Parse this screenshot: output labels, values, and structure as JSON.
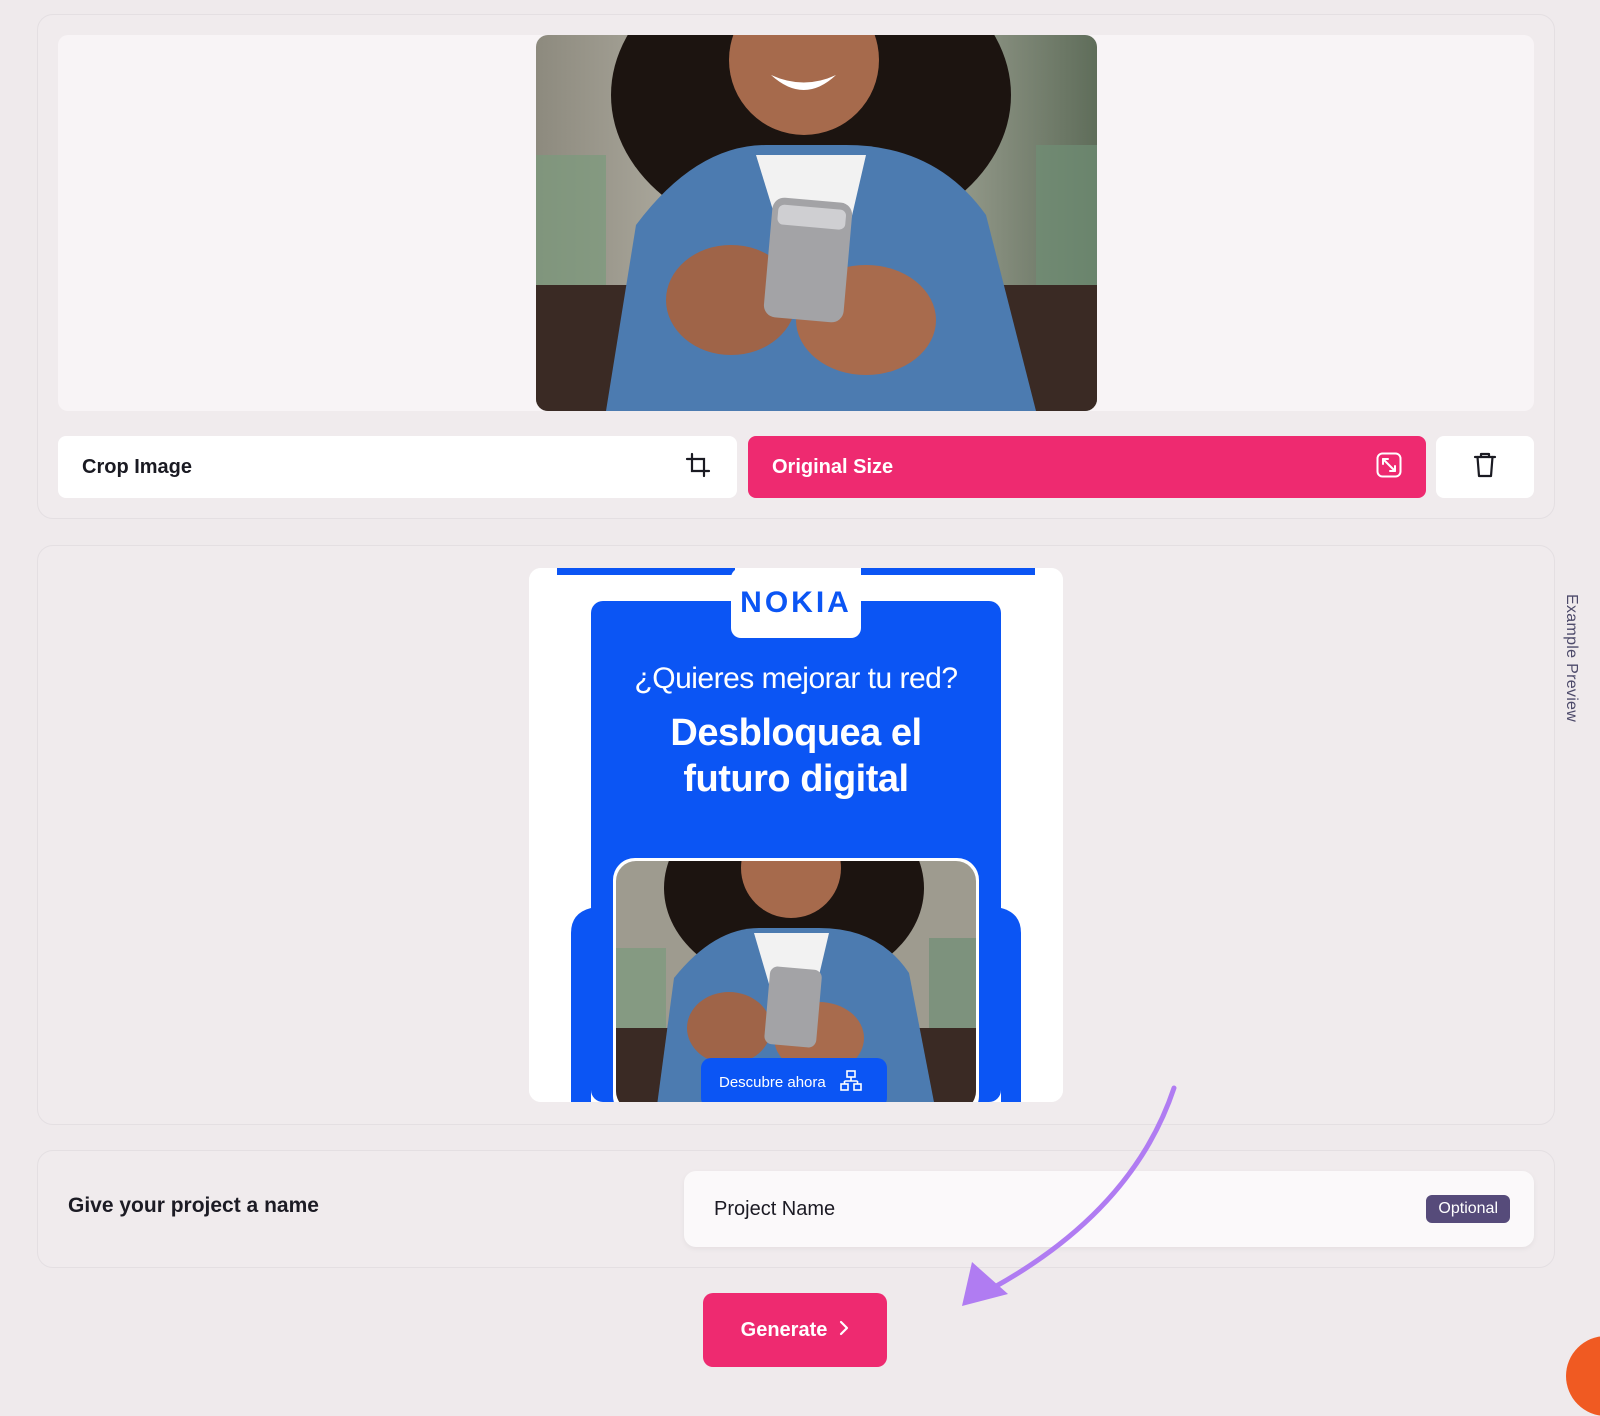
{
  "upload": {
    "crop_label": "Crop Image",
    "original_size_label": "Original Size",
    "crop_icon": "crop-icon",
    "resize_icon": "resize-icon",
    "delete_icon": "trash-icon"
  },
  "preview": {
    "side_label": "Example Preview",
    "ad": {
      "brand": "NOKIA",
      "question": "¿Quieres mejorar tu red?",
      "headline_line1": "Desbloquea el",
      "headline_line2": "futuro digital",
      "cta": "Descubre ahora",
      "cta_icon": "network-icon"
    }
  },
  "project": {
    "label": "Give your project a name",
    "placeholder": "Project Name",
    "badge": "Optional"
  },
  "generate": {
    "label": "Generate",
    "icon": "chevron-right-icon"
  },
  "colors": {
    "accent": "#ee2a70",
    "nokia_blue": "#0b55f4",
    "badge": "#564b7a",
    "annotation_arrow": "#b07cf2"
  }
}
